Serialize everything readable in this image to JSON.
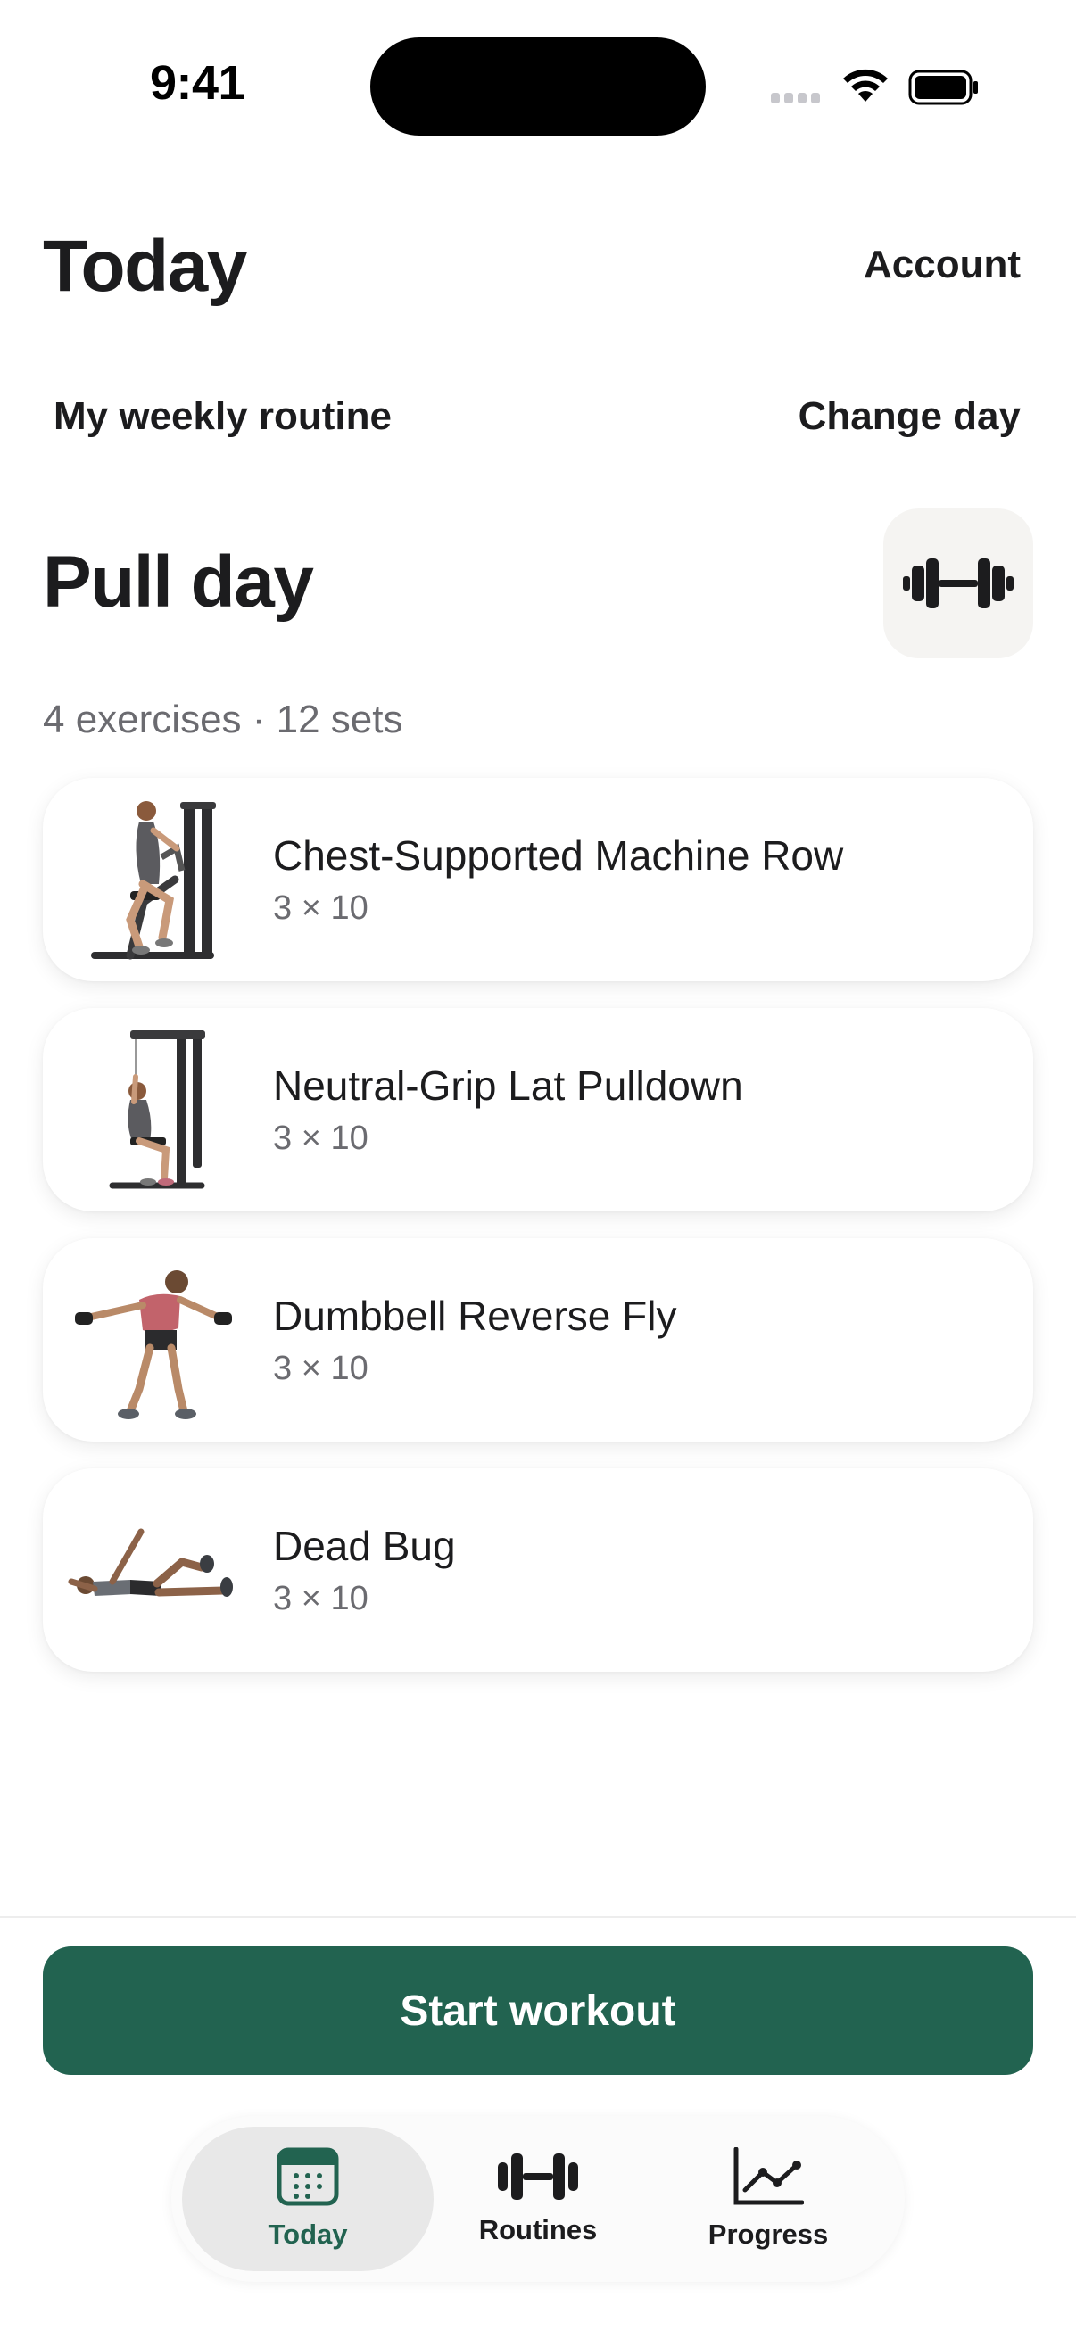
{
  "status_bar": {
    "time": "9:41"
  },
  "header": {
    "title": "Today",
    "account_label": "Account",
    "routine_label": "My weekly routine",
    "change_day_label": "Change day"
  },
  "day": {
    "title": "Pull day",
    "icon": "dumbbell-icon",
    "summary": "4 exercises · 12 sets"
  },
  "exercises": [
    {
      "name": "Chest-Supported Machine Row",
      "sets": "3 × 10",
      "image": "machine-row-figure"
    },
    {
      "name": "Neutral-Grip Lat Pulldown",
      "sets": "3 × 10",
      "image": "lat-pulldown-figure"
    },
    {
      "name": "Dumbbell Reverse Fly",
      "sets": "3 × 10",
      "image": "reverse-fly-figure"
    },
    {
      "name": "Dead Bug",
      "sets": "3 × 10",
      "image": "dead-bug-figure"
    }
  ],
  "start_button": {
    "label": "Start workout"
  },
  "tabs": [
    {
      "label": "Today",
      "icon": "calendar-icon",
      "active": true
    },
    {
      "label": "Routines",
      "icon": "dumbbell-icon",
      "active": false
    },
    {
      "label": "Progress",
      "icon": "chart-line-icon",
      "active": false
    }
  ],
  "colors": {
    "accent": "#226350",
    "text_primary": "#1c1c1e",
    "text_secondary": "#6b6b70",
    "active_tab_bg": "#e8e8e8"
  }
}
